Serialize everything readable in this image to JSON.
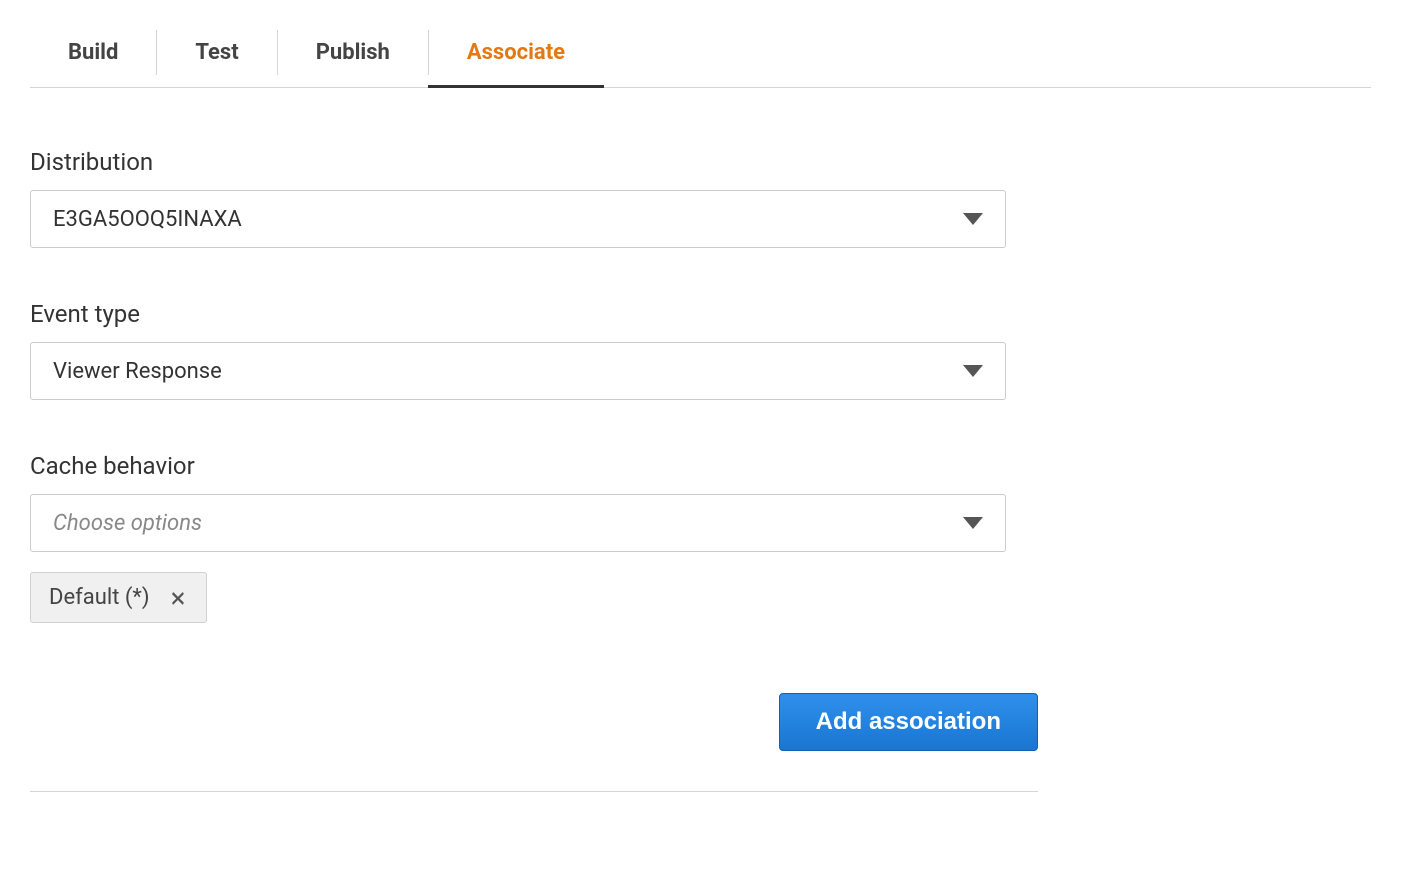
{
  "tabs": {
    "build": "Build",
    "test": "Test",
    "publish": "Publish",
    "associate": "Associate"
  },
  "form": {
    "distribution": {
      "label": "Distribution",
      "value": "E3GA5OOQ5INAXA"
    },
    "event_type": {
      "label": "Event type",
      "value": "Viewer Response"
    },
    "cache_behavior": {
      "label": "Cache behavior",
      "placeholder": "Choose options",
      "chip": "Default (*)"
    }
  },
  "actions": {
    "add_association": "Add association"
  }
}
